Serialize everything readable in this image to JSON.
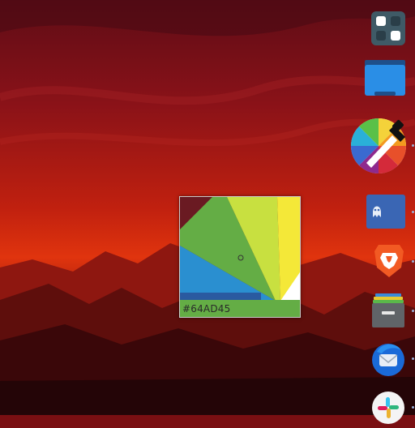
{
  "color_picker": {
    "hex_value": "#64AD45",
    "swatch_color": "#64AD45"
  },
  "dock": {
    "items": [
      {
        "name": "app-launcher",
        "icon": "grid-icon"
      },
      {
        "name": "file-manager",
        "icon": "folder-icon"
      },
      {
        "name": "color-picker",
        "icon": "color-wheel-icon"
      },
      {
        "name": "ghost-app",
        "icon": "ghost-icon"
      },
      {
        "name": "brave-browser",
        "icon": "lion-icon"
      },
      {
        "name": "archive",
        "icon": "archive-box-icon"
      },
      {
        "name": "thunderbird",
        "icon": "thunderbird-icon"
      },
      {
        "name": "slack",
        "icon": "slack-icon"
      }
    ]
  },
  "colors": {
    "wallpaper_top": "#6a0f18",
    "wallpaper_mid": "#d02a10",
    "wallpaper_bottom": "#2a0608"
  }
}
